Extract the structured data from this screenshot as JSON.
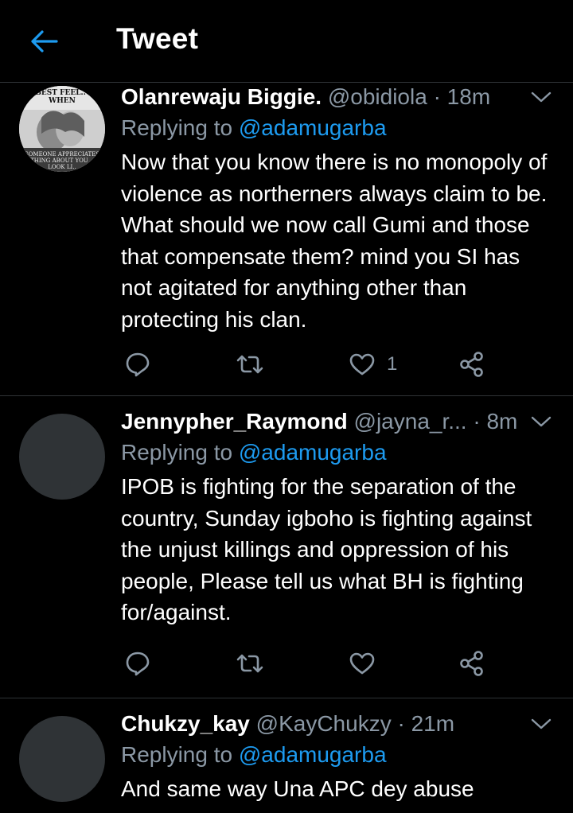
{
  "app_bar": {
    "title": "Tweet",
    "back_icon": "arrow-left-icon"
  },
  "colors": {
    "background": "#000000",
    "accent": "#1d9bf0",
    "muted": "#8b98a5",
    "divider": "#2f3336"
  },
  "tweets": [
    {
      "name": "Olanrewaju Biggie.",
      "handle": "@obidiola",
      "time": "· 18m",
      "replying_prefix": "Replying to",
      "replying_to": "@adamugarba",
      "text": "Now that you know there is no monopoly of violence as northerners always claim to be. What should we now call Gumi and those that compensate them? mind you SI has not agitated for anything other than protecting his clan.",
      "like_count": "1",
      "avatar_caption_top": "E BEST FEEL.. IS WHEN",
      "avatar_caption_bottom": "SOMEONE APPRECIATES YTHING ABOUT YOU ..E LOOK LI.."
    },
    {
      "name": "Jennypher_Raymond",
      "handle": "@jayna_r...",
      "time": "· 8m",
      "replying_prefix": "Replying to",
      "replying_to": "@adamugarba",
      "text": "IPOB is fighting for the separation of the country, Sunday igboho is fighting against the unjust killings and oppression of his people, Please tell us what BH is fighting for/against.",
      "like_count": ""
    },
    {
      "name": "Chukzy_kay",
      "handle": "@KayChukzy",
      "time": "· 21m",
      "replying_prefix": "Replying to",
      "replying_to": "@adamugarba",
      "text": "And same way Una APC dey abuse"
    }
  ]
}
